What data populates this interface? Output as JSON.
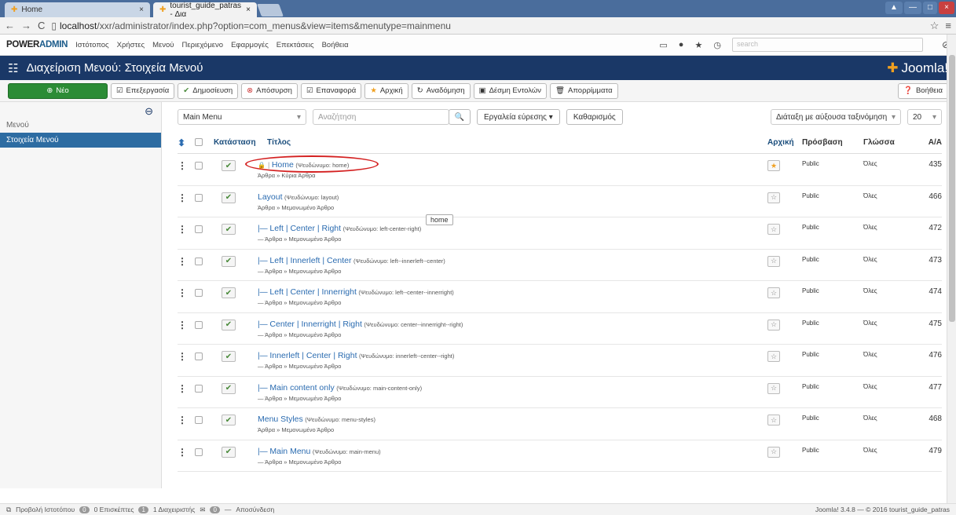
{
  "browser": {
    "tabs": [
      {
        "label": "Home",
        "close": "×"
      },
      {
        "label": "tourist_guide_patras - Δια",
        "close": "×"
      }
    ],
    "url_host": "localhost",
    "url_path": "/xxr/administrator/index.php?option=com_menus&view=items&menutype=mainmenu"
  },
  "admin": {
    "brand_a": "POWER",
    "brand_b": "ADMIN",
    "menu": [
      "Ιστότοπος",
      "Χρήστες",
      "Μενού",
      "Περιεχόμενο",
      "Εφαρμογές",
      "Επεκτάσεις",
      "Βοήθεια"
    ],
    "search_placeholder": "search"
  },
  "header": {
    "title": "Διαχείριση Μενού: Στοιχεία Μενού",
    "logo": "Joomla!"
  },
  "toolbar": {
    "new": "Νέο",
    "edit": "Επεξεργασία",
    "publish": "Δημοσίευση",
    "unpublish": "Απόσυρση",
    "checkin": "Επαναφορά",
    "home": "Αρχική",
    "rebuild": "Αναδόμηση",
    "batch": "Δέσμη Εντολών",
    "trash": "Απορρίμματα",
    "help": "Βοήθεια"
  },
  "sidebar": {
    "menus": "Μενού",
    "items": "Στοιχεία Μενού"
  },
  "filters": {
    "menu": "Main Menu",
    "search_placeholder": "Αναζήτηση",
    "tools": "Εργαλεία εύρεσης ▾",
    "clear": "Καθαρισμός",
    "sort": "Διάταξη με αύξουσα ταξινόμηση",
    "limit": "20"
  },
  "table": {
    "headers": {
      "status": "Κατάσταση",
      "title": "Τίτλος",
      "home": "Αρχική",
      "access": "Πρόσβαση",
      "lang": "Γλώσσα",
      "id": "Α/Α"
    },
    "rows": [
      {
        "name": "Home",
        "alias": "(Ψευδώνυμο: home)",
        "sub": "Άρθρα » Κύρια Άρθρα",
        "access": "Public",
        "lang": "Όλες",
        "id": "435",
        "home": true,
        "prefix": "",
        "locked": true
      },
      {
        "name": "Layout",
        "alias": "(Ψευδώνυμο: layout)",
        "sub": "Άρθρα » Μεμονωμένο Άρθρο",
        "access": "Public",
        "lang": "Όλες",
        "id": "466",
        "home": false,
        "prefix": "",
        "locked": false
      },
      {
        "name": "Left | Center | Right",
        "alias": "(Ψευδώνυμο: left-center-right)",
        "sub": "— Άρθρα » Μεμονωμένο Άρθρο",
        "access": "Public",
        "lang": "Όλες",
        "id": "472",
        "home": false,
        "prefix": "|— ",
        "locked": false
      },
      {
        "name": "Left | Innerleft | Center",
        "alias": "(Ψευδώνυμο: left--innerleft--center)",
        "sub": "— Άρθρα » Μεμονωμένο Άρθρο",
        "access": "Public",
        "lang": "Όλες",
        "id": "473",
        "home": false,
        "prefix": "|— ",
        "locked": false
      },
      {
        "name": "Left | Center | Innerright",
        "alias": "(Ψευδώνυμο: left--center--innerright)",
        "sub": "— Άρθρα » Μεμονωμένο Άρθρο",
        "access": "Public",
        "lang": "Όλες",
        "id": "474",
        "home": false,
        "prefix": "|— ",
        "locked": false
      },
      {
        "name": "Center | Innerright | Right",
        "alias": "(Ψευδώνυμο: center--innerright--right)",
        "sub": "— Άρθρα » Μεμονωμένο Άρθρο",
        "access": "Public",
        "lang": "Όλες",
        "id": "475",
        "home": false,
        "prefix": "|— ",
        "locked": false
      },
      {
        "name": "Innerleft | Center | Right",
        "alias": "(Ψευδώνυμο: innerleft--center--right)",
        "sub": "— Άρθρα » Μεμονωμένο Άρθρο",
        "access": "Public",
        "lang": "Όλες",
        "id": "476",
        "home": false,
        "prefix": "|— ",
        "locked": false
      },
      {
        "name": "Main content only",
        "alias": "(Ψευδώνυμο: main-content-only)",
        "sub": "— Άρθρα » Μεμονωμένο Άρθρο",
        "access": "Public",
        "lang": "Όλες",
        "id": "477",
        "home": false,
        "prefix": "|— ",
        "locked": false
      },
      {
        "name": "Menu Styles",
        "alias": "(Ψευδώνυμο: menu-styles)",
        "sub": "Άρθρα » Μεμονωμένο Άρθρο",
        "access": "Public",
        "lang": "Όλες",
        "id": "468",
        "home": false,
        "prefix": "",
        "locked": false
      },
      {
        "name": "Main Menu",
        "alias": "(Ψευδώνυμο: main-menu)",
        "sub": "— Άρθρα » Μεμονωμένο Άρθρο",
        "access": "Public",
        "lang": "Όλες",
        "id": "479",
        "home": false,
        "prefix": "|— ",
        "locked": false
      }
    ]
  },
  "tooltip": "home",
  "footer": {
    "preview": "Προβολή Ιστοτόπου",
    "visitors_count": "0",
    "visitors": "0 Επισκέπτες",
    "admins_count": "1",
    "admins": "1 Διαχειριστής",
    "msgs_count": "0",
    "logout": "Αποσύνδεση",
    "version": "Joomla! 3.4.8 — © 2016 tourist_guide_patras"
  },
  "colors": {
    "header": "#1a3867",
    "new_button": "#2c8c36",
    "sidebar_active": "#2d6ca2",
    "highlight": "#d42020"
  }
}
